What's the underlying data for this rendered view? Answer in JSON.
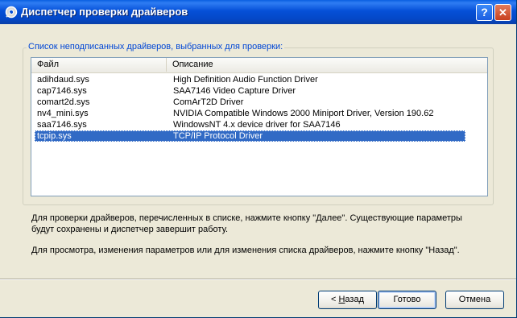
{
  "window": {
    "title": "Диспетчер проверки драйверов",
    "help_label": "?",
    "close_label": "✕"
  },
  "group": {
    "legend": "Список неподписанных драйверов, выбранных для проверки:"
  },
  "list": {
    "columns": [
      "Файл",
      "Описание"
    ],
    "rows": [
      {
        "file": "adihdaud.sys",
        "description": "High Definition Audio Function Driver"
      },
      {
        "file": "cap7146.sys",
        "description": "SAA7146 Video Capture Driver"
      },
      {
        "file": "comart2d.sys",
        "description": "ComArT2D Driver"
      },
      {
        "file": "nv4_mini.sys",
        "description": "NVIDIA Compatible Windows 2000 Miniport Driver, Version 190.62"
      },
      {
        "file": "saa7146.sys",
        "description": "WindowsNT 4.x device driver for SAA7146"
      },
      {
        "file": "tcpip.sys",
        "description": "TCP/IP Protocol Driver"
      }
    ],
    "selected_index": 5
  },
  "info": {
    "line1": "Для проверки драйверов, перечисленных в списке, нажмите кнопку \"Далее\". Существующие параметры",
    "line2": "будут сохранены и диспетчер завершит работу.",
    "line3": "Для просмотра, изменения параметров или для изменения списка драйверов, нажмите кнопку \"Назад\"."
  },
  "buttons": {
    "back_prefix": "< ",
    "back_hotkey": "Н",
    "back_rest": "азад",
    "ready": "Готово",
    "cancel": "Отмена"
  },
  "colors": {
    "titlebar": "#0550D8",
    "selection": "#316AC5",
    "legend_text": "#0046D5",
    "dialog_bg": "#ECE9D8"
  }
}
